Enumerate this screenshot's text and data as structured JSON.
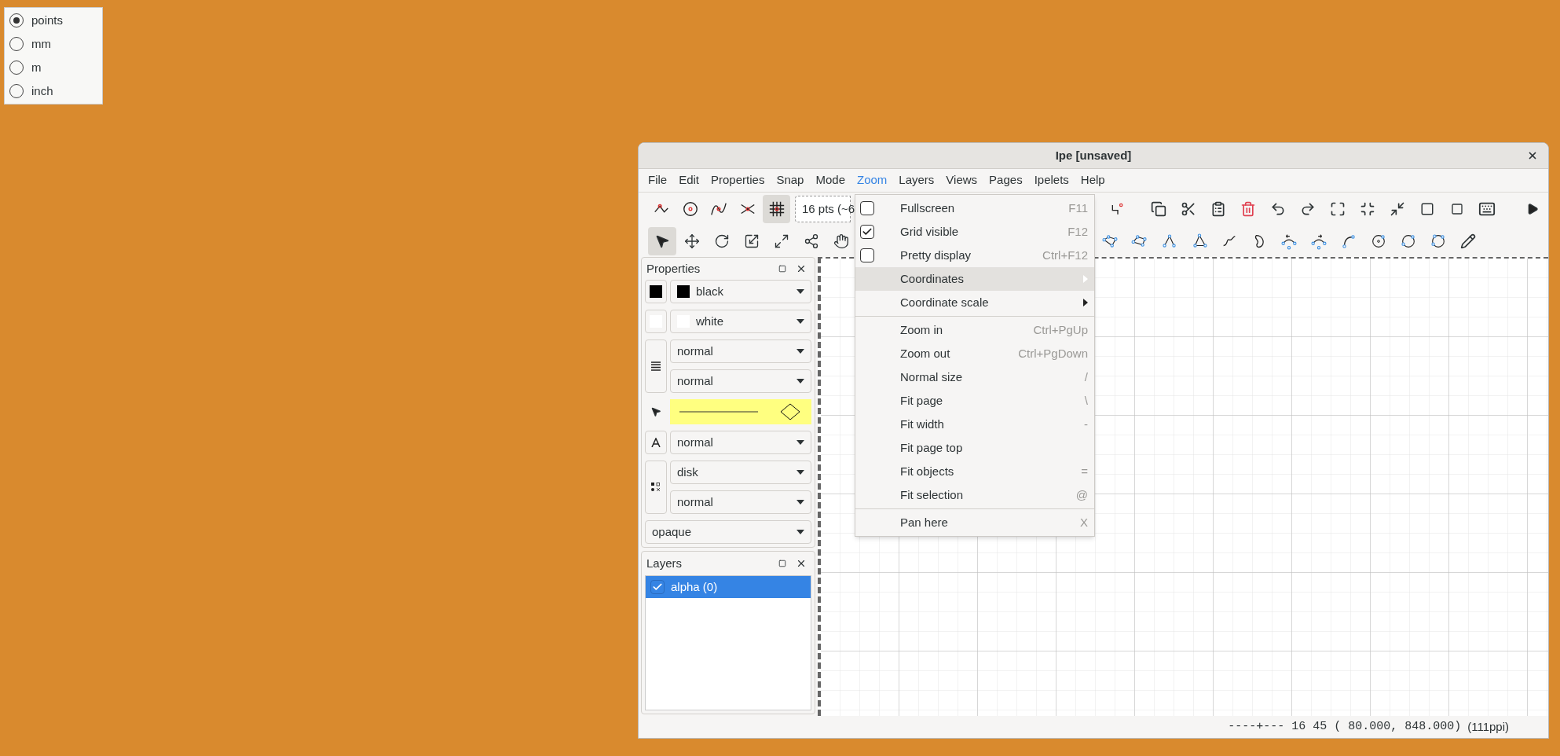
{
  "unit_options": [
    {
      "label": "points",
      "selected": true
    },
    {
      "label": "mm",
      "selected": false
    },
    {
      "label": "m",
      "selected": false
    },
    {
      "label": "inch",
      "selected": false
    }
  ],
  "window": {
    "title": "Ipe [unsaved]"
  },
  "menu_bar": [
    {
      "label": "File",
      "selected": false
    },
    {
      "label": "Edit",
      "selected": false
    },
    {
      "label": "Properties",
      "selected": false
    },
    {
      "label": "Snap",
      "selected": false
    },
    {
      "label": "Mode",
      "selected": false
    },
    {
      "label": "Zoom",
      "selected": true
    },
    {
      "label": "Layers",
      "selected": false
    },
    {
      "label": "Views",
      "selected": false
    },
    {
      "label": "Pages",
      "selected": false
    },
    {
      "label": "Ipelets",
      "selected": false
    },
    {
      "label": "Help",
      "selected": false
    }
  ],
  "snap_tools": [
    {
      "kind": "vertex",
      "on": false
    },
    {
      "kind": "boundary",
      "on": false
    },
    {
      "kind": "curve",
      "on": false
    },
    {
      "kind": "intersection",
      "on": false
    },
    {
      "kind": "grid",
      "on": true
    }
  ],
  "grid_size": {
    "value": "16 pts (~6"
  },
  "mode_tools": [
    {
      "kind": "select",
      "selected": true
    },
    {
      "kind": "translate",
      "selected": false
    },
    {
      "kind": "rotate",
      "selected": false
    },
    {
      "kind": "stretch",
      "selected": false
    },
    {
      "kind": "shear",
      "selected": false
    },
    {
      "kind": "graph",
      "selected": false
    },
    {
      "kind": "pan",
      "selected": false
    }
  ],
  "properties": {
    "title": "Properties",
    "colors": [
      {
        "value": "black",
        "color": "#000000"
      },
      {
        "value": "white",
        "color": "#ffffff"
      }
    ],
    "pen": "normal",
    "dash": "normal",
    "text_size": "normal",
    "mark_shape": "disk",
    "symbol_size": "normal",
    "opacity": "opaque"
  },
  "layers": {
    "title": "Layers",
    "items": [
      {
        "name": "alpha (0)",
        "checked": true,
        "selected": true
      }
    ]
  },
  "zoom_menu": [
    {
      "kind": "check",
      "label": "Fullscreen",
      "shortcut": "F11",
      "checked": false,
      "selected": false
    },
    {
      "kind": "check",
      "label": "Grid visible",
      "shortcut": "F12",
      "checked": true,
      "selected": false
    },
    {
      "kind": "check",
      "label": "Pretty display",
      "shortcut": "Ctrl+F12",
      "checked": false,
      "selected": false
    },
    {
      "kind": "submenu",
      "label": "Coordinates",
      "selected": true
    },
    {
      "kind": "submenu",
      "label": "Coordinate scale",
      "selected": false
    },
    {
      "kind": "separator"
    },
    {
      "kind": "action",
      "label": "Zoom in",
      "shortcut": "Ctrl+PgUp",
      "selected": false
    },
    {
      "kind": "action",
      "label": "Zoom out",
      "shortcut": "Ctrl+PgDown",
      "selected": false
    },
    {
      "kind": "action",
      "label": "Normal size",
      "shortcut": "/",
      "selected": false
    },
    {
      "kind": "action",
      "label": "Fit page",
      "shortcut": "\\",
      "selected": false
    },
    {
      "kind": "action",
      "label": "Fit width",
      "shortcut": "-",
      "selected": false
    },
    {
      "kind": "action",
      "label": "Fit page top",
      "selected": false
    },
    {
      "kind": "action",
      "label": "Fit objects",
      "shortcut": "=",
      "selected": false
    },
    {
      "kind": "action",
      "label": "Fit selection",
      "shortcut": "@",
      "selected": false
    },
    {
      "kind": "separator"
    },
    {
      "kind": "action",
      "label": "Pan here",
      "shortcut": "X",
      "selected": false
    }
  ],
  "status_bar": {
    "position": "----+--- 16 45 ( 80.000, 848.000)",
    "resolution": "(111ppi)"
  }
}
